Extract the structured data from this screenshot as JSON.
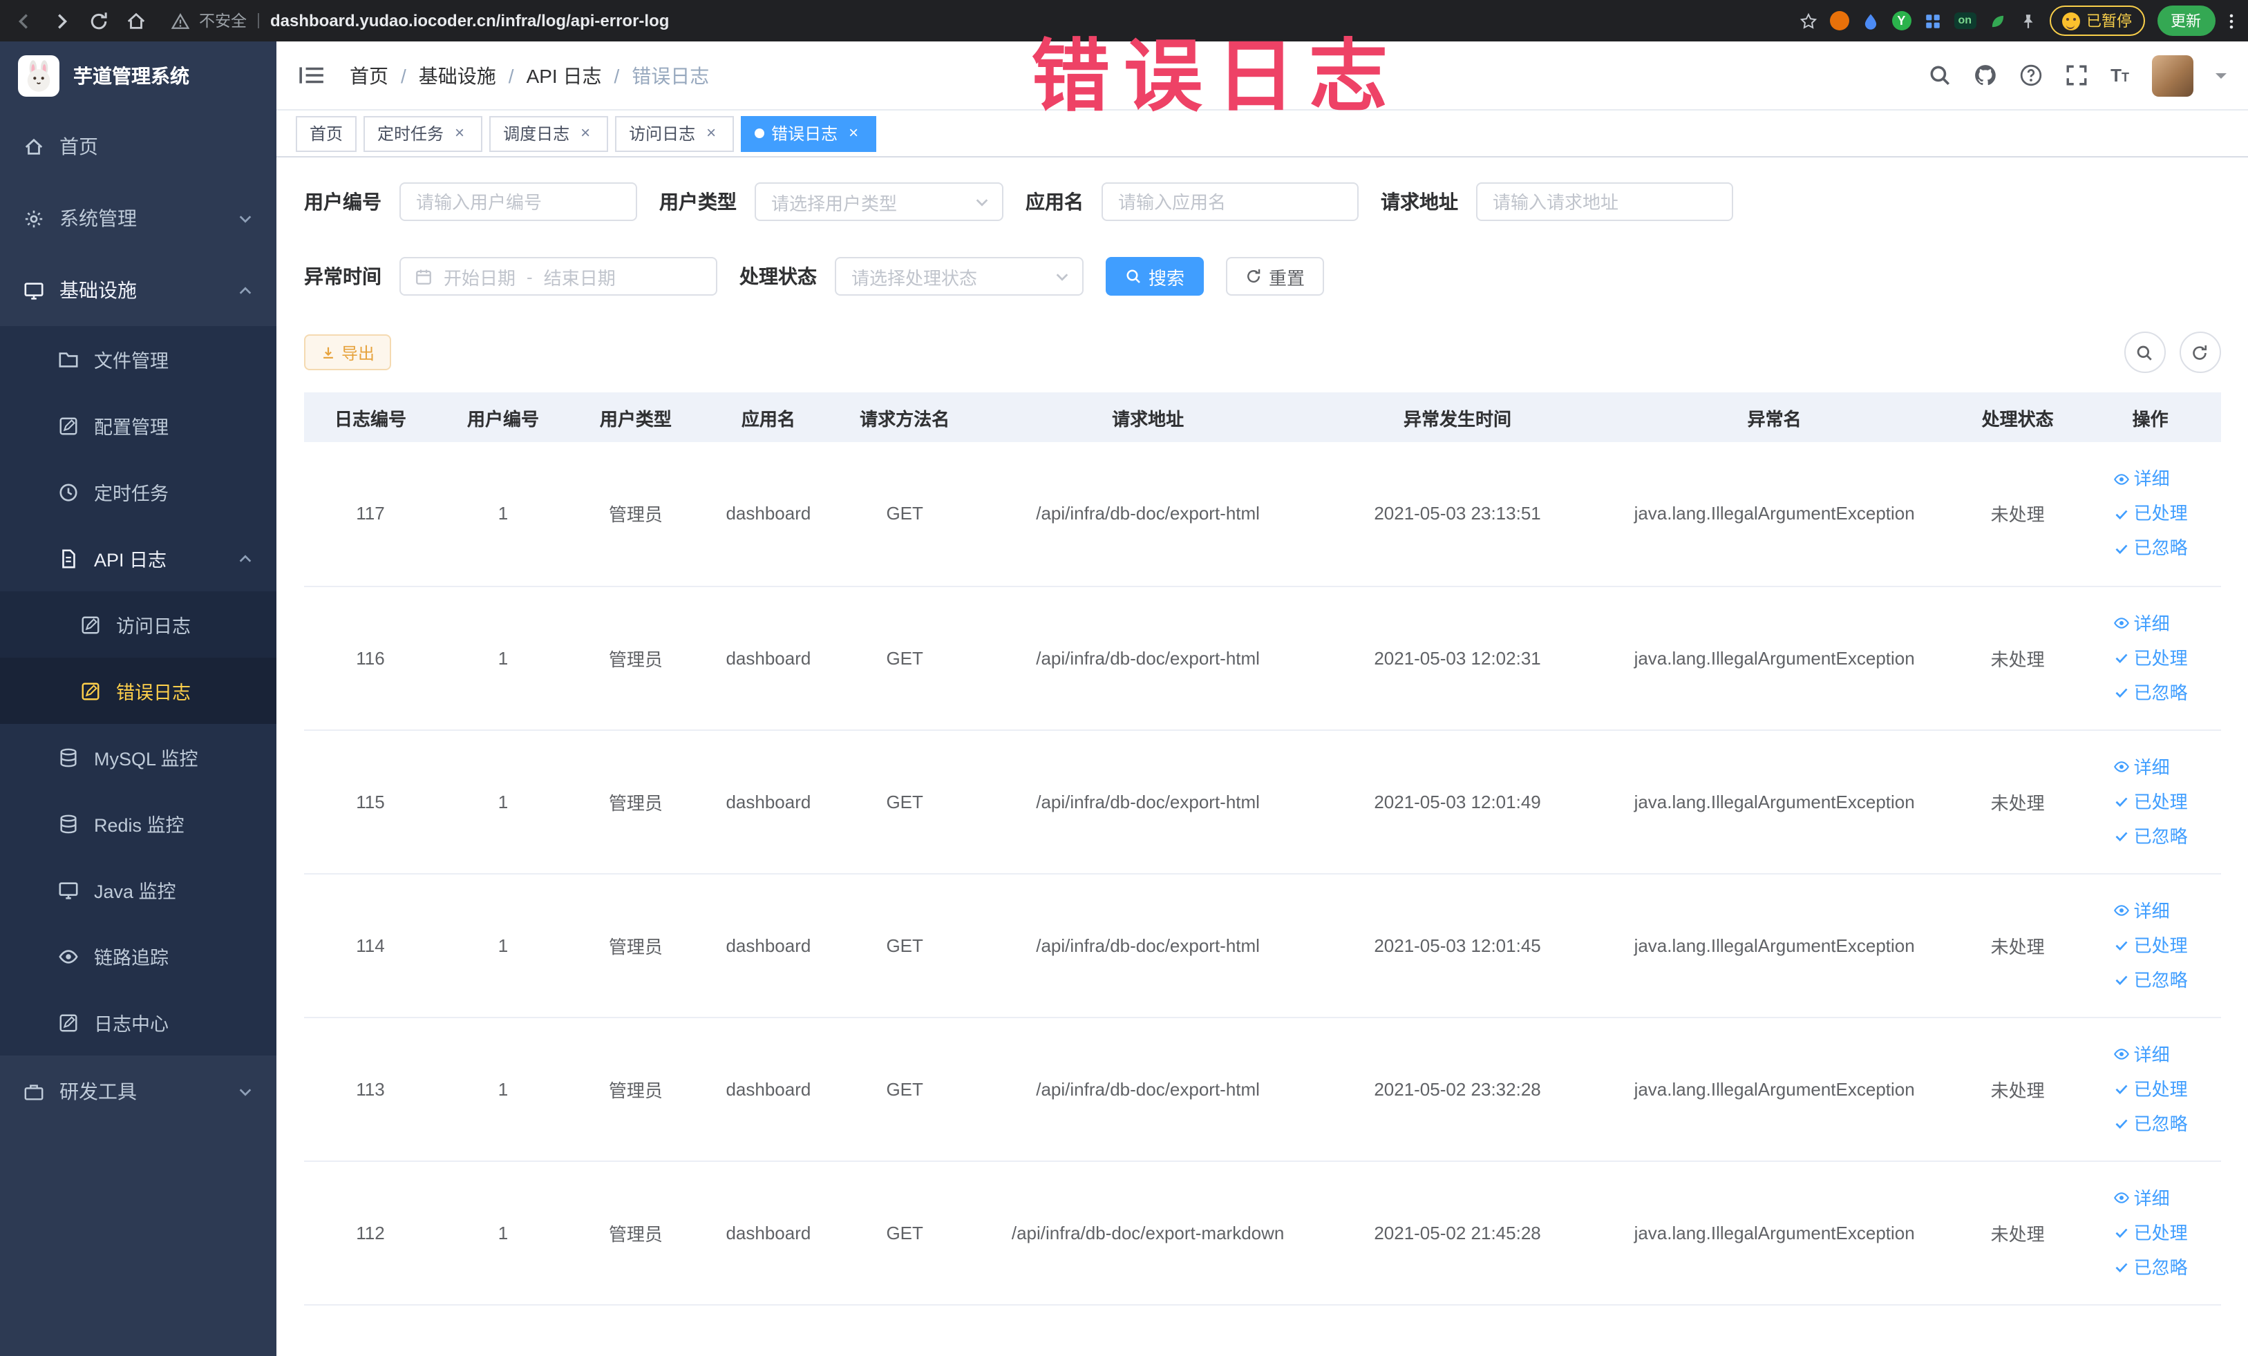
{
  "browser": {
    "security_label": "不安全",
    "url": "dashboard.yudao.iocoder.cn/infra/log/api-error-log",
    "extension_y_label": "Y",
    "extension_on_label": "on",
    "paused_badge": "已暂停",
    "update_button": "更新"
  },
  "watermark": "错误日志",
  "sidebar": {
    "logo_title": "芋道管理系统",
    "items": [
      {
        "label": "首页"
      },
      {
        "label": "系统管理"
      },
      {
        "label": "基础设施"
      },
      {
        "label": "文件管理"
      },
      {
        "label": "配置管理"
      },
      {
        "label": "定时任务"
      },
      {
        "label": "API 日志"
      },
      {
        "label": "访问日志"
      },
      {
        "label": "错误日志"
      },
      {
        "label": "MySQL 监控"
      },
      {
        "label": "Redis 监控"
      },
      {
        "label": "Java 监控"
      },
      {
        "label": "链路追踪"
      },
      {
        "label": "日志中心"
      },
      {
        "label": "研发工具"
      }
    ]
  },
  "header": {
    "breadcrumb": [
      "首页",
      "基础设施",
      "API 日志",
      "错误日志"
    ]
  },
  "tabs": [
    {
      "label": "首页"
    },
    {
      "label": "定时任务"
    },
    {
      "label": "调度日志"
    },
    {
      "label": "访问日志"
    },
    {
      "label": "错误日志"
    }
  ],
  "filters": {
    "user_id_label": "用户编号",
    "user_id_placeholder": "请输入用户编号",
    "user_type_label": "用户类型",
    "user_type_placeholder": "请选择用户类型",
    "app_name_label": "应用名",
    "app_name_placeholder": "请输入应用名",
    "request_url_label": "请求地址",
    "request_url_placeholder": "请输入请求地址",
    "exception_time_label": "异常时间",
    "start_date_placeholder": "开始日期",
    "end_date_placeholder": "结束日期",
    "date_separator": "-",
    "process_status_label": "处理状态",
    "process_status_placeholder": "请选择处理状态",
    "search_label": "搜索",
    "reset_label": "重置"
  },
  "toolbar": {
    "export_label": "导出"
  },
  "table": {
    "columns": [
      "日志编号",
      "用户编号",
      "用户类型",
      "应用名",
      "请求方法名",
      "请求地址",
      "异常发生时间",
      "异常名",
      "处理状态",
      "操作"
    ],
    "actions": [
      "详细",
      "已处理",
      "已忽略"
    ],
    "rows": [
      {
        "id": "117",
        "user_id": "1",
        "user_type": "管理员",
        "app": "dashboard",
        "method": "GET",
        "url": "/api/infra/db-doc/export-html",
        "time": "2021-05-03 23:13:51",
        "exception": "java.lang.IllegalArgumentException",
        "status": "未处理"
      },
      {
        "id": "116",
        "user_id": "1",
        "user_type": "管理员",
        "app": "dashboard",
        "method": "GET",
        "url": "/api/infra/db-doc/export-html",
        "time": "2021-05-03 12:02:31",
        "exception": "java.lang.IllegalArgumentException",
        "status": "未处理"
      },
      {
        "id": "115",
        "user_id": "1",
        "user_type": "管理员",
        "app": "dashboard",
        "method": "GET",
        "url": "/api/infra/db-doc/export-html",
        "time": "2021-05-03 12:01:49",
        "exception": "java.lang.IllegalArgumentException",
        "status": "未处理"
      },
      {
        "id": "114",
        "user_id": "1",
        "user_type": "管理员",
        "app": "dashboard",
        "method": "GET",
        "url": "/api/infra/db-doc/export-html",
        "time": "2021-05-03 12:01:45",
        "exception": "java.lang.IllegalArgumentException",
        "status": "未处理"
      },
      {
        "id": "113",
        "user_id": "1",
        "user_type": "管理员",
        "app": "dashboard",
        "method": "GET",
        "url": "/api/infra/db-doc/export-html",
        "time": "2021-05-02 23:32:28",
        "exception": "java.lang.IllegalArgumentException",
        "status": "未处理"
      },
      {
        "id": "112",
        "user_id": "1",
        "user_type": "管理员",
        "app": "dashboard",
        "method": "GET",
        "url": "/api/infra/db-doc/export-markdown",
        "time": "2021-05-02 21:45:28",
        "exception": "java.lang.IllegalArgumentException",
        "status": "未处理"
      }
    ]
  },
  "colors": {
    "accent": "#409eff",
    "menu_active_text": "#ffd04b",
    "sidebar_bg": "#2d3a53",
    "export_warning": "#e6a23c",
    "watermark_red": "#ee4266"
  }
}
